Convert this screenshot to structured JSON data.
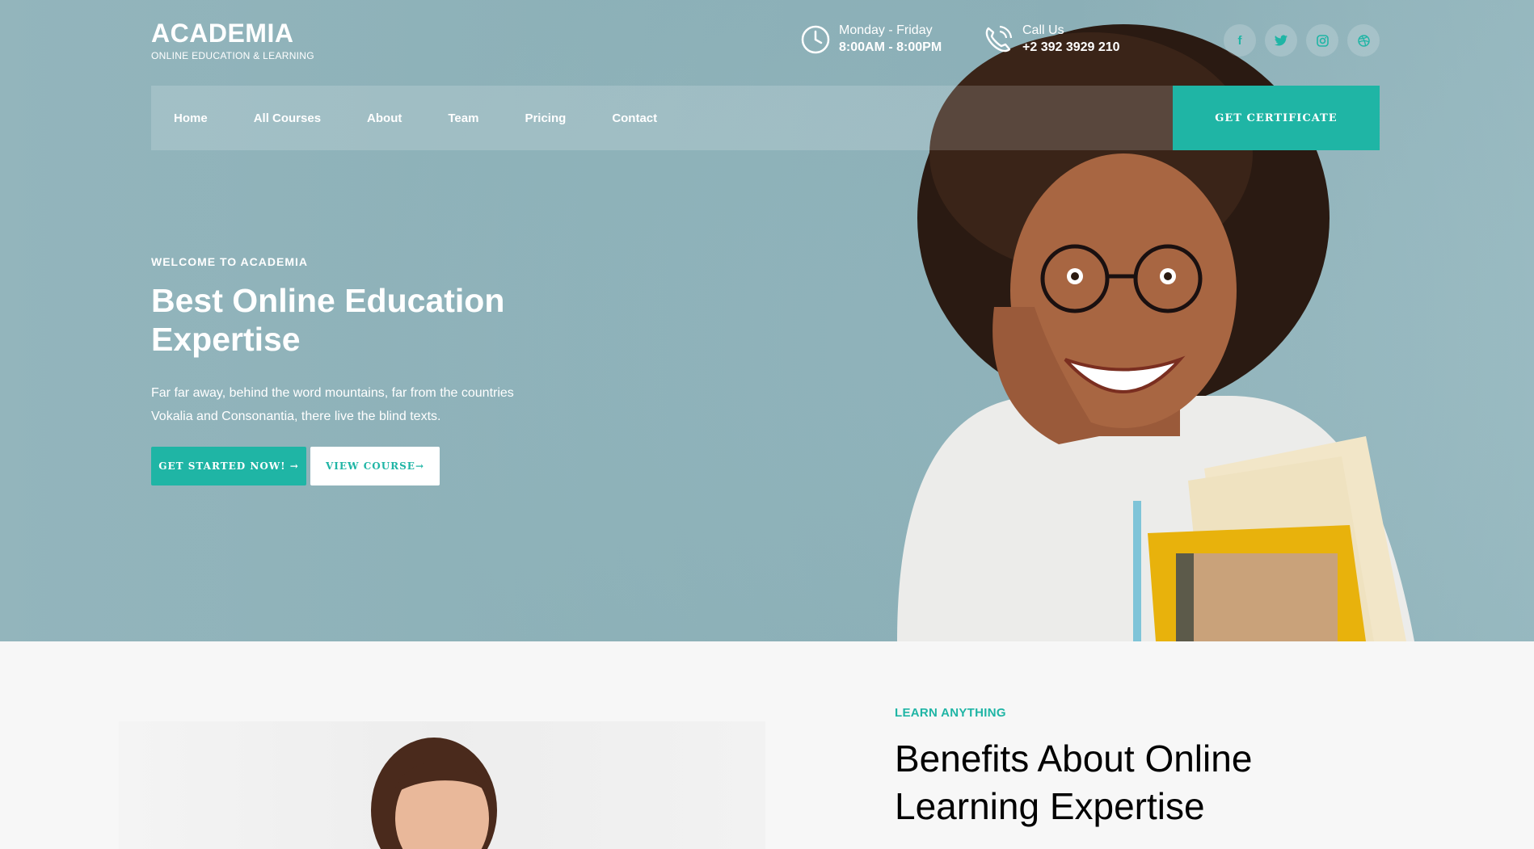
{
  "brand": {
    "name": "ACADEMIA",
    "tagline": "ONLINE EDUCATION & LEARNING"
  },
  "header": {
    "hours": {
      "label": "Monday - Friday",
      "value": "8:00AM - 8:00PM"
    },
    "call": {
      "label": "Call Us",
      "value": "+2 392 3929 210"
    },
    "socials": [
      {
        "name": "facebook",
        "glyph": "f"
      },
      {
        "name": "twitter",
        "glyph": "t"
      },
      {
        "name": "instagram",
        "glyph": "◎"
      },
      {
        "name": "dribbble",
        "glyph": "⊕"
      }
    ]
  },
  "nav": {
    "items": [
      "Home",
      "All Courses",
      "About",
      "Team",
      "Pricing",
      "Contact"
    ],
    "cta": "GET CERTIFICATE"
  },
  "hero": {
    "kicker": "WELCOME TO ACADEMIA",
    "title": "Best Online Education Expertise",
    "lead": "Far far away, behind the word mountains, far from the countries Vokalia and Consonantia, there live the blind texts.",
    "primary_btn": "GET STARTED NOW! →",
    "secondary_btn": "VIEW COURSE→"
  },
  "benefits": {
    "kicker": "LEARN ANYTHING",
    "title": "Benefits About Online Learning Expertise"
  },
  "colors": {
    "accent": "#1fb5a5",
    "hero_bg": "#93b6bd",
    "page_bg": "#f7f7f7"
  }
}
